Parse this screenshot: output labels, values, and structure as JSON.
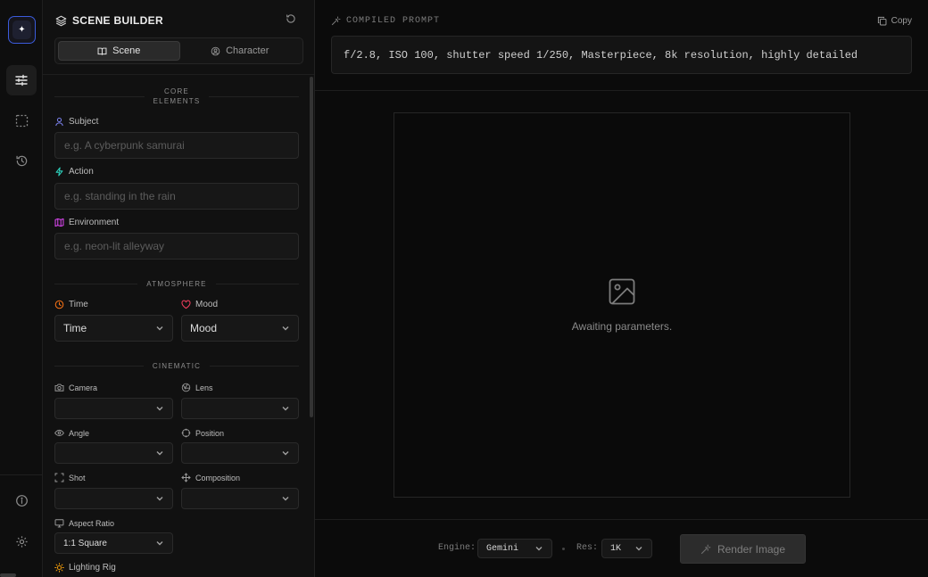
{
  "rail": {
    "logo_glyph": "✦",
    "items": [
      {
        "name": "builder",
        "icon": "sliders-icon",
        "active": true
      },
      {
        "name": "gallery",
        "icon": "frame-icon",
        "active": false
      },
      {
        "name": "history",
        "icon": "history-icon",
        "active": false
      }
    ],
    "bottom_items": [
      {
        "name": "info",
        "icon": "info-icon"
      },
      {
        "name": "settings",
        "icon": "gear-icon"
      }
    ]
  },
  "panel": {
    "title": "SCENE BUILDER",
    "tabs": [
      {
        "label": "Scene",
        "active": true
      },
      {
        "label": "Character",
        "active": false
      }
    ],
    "sections": {
      "core_line1": "CORE",
      "core_line2": "ELEMENTS",
      "atmosphere": "ATMOSPHERE",
      "cinematic": "CINEMATIC"
    },
    "fields": {
      "subject": {
        "label": "Subject",
        "value": "",
        "placeholder": "e.g. A cyberpunk samurai"
      },
      "action": {
        "label": "Action",
        "value": "",
        "placeholder": "e.g. standing in the rain"
      },
      "environment": {
        "label": "Environment",
        "value": "",
        "placeholder": "e.g. neon-lit alleyway"
      },
      "time": {
        "label": "Time",
        "value": "Time"
      },
      "mood": {
        "label": "Mood",
        "value": "Mood"
      },
      "camera": {
        "label": "Camera",
        "value": ""
      },
      "lens": {
        "label": "Lens",
        "value": ""
      },
      "angle": {
        "label": "Angle",
        "value": ""
      },
      "position": {
        "label": "Position",
        "value": ""
      },
      "shot": {
        "label": "Shot",
        "value": ""
      },
      "composition": {
        "label": "Composition",
        "value": ""
      },
      "aspect_ratio": {
        "label": "Aspect Ratio",
        "value": "1:1 Square"
      },
      "lighting_rig": {
        "label": "Lighting Rig"
      }
    }
  },
  "main": {
    "compiled_label": "COMPILED PROMPT",
    "copy_label": "Copy",
    "prompt": "f/2.8, ISO 100, shutter speed 1/250, Masterpiece, 8k resolution, highly detailed",
    "awaiting": "Awaiting parameters.",
    "footer": {
      "engine_label": "Engine:",
      "engine_value": "Gemini",
      "res_label": "Res:",
      "res_value": "1K",
      "render_label": "Render Image"
    }
  },
  "colors": {
    "accent": "#3b5bdb",
    "subject_icon": "#7c83f0",
    "action_icon": "#2dd4bf",
    "environment_icon": "#d946ef",
    "time_icon": "#f97316",
    "mood_icon": "#f43f5e",
    "lighting_icon": "#f59e0b"
  }
}
